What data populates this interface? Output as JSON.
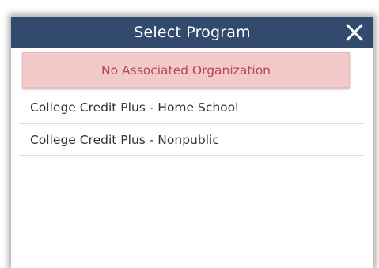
{
  "dialog": {
    "title": "Select Program",
    "close_icon": "close-icon",
    "colors": {
      "header_bg": "#324a6d",
      "header_text": "#ffffff",
      "alert_bg": "#f3c9c9",
      "alert_text": "#b24a4f"
    }
  },
  "alert": {
    "message": "No Associated Organization"
  },
  "programs": [
    {
      "label": "College Credit Plus - Home School"
    },
    {
      "label": "College Credit Plus - Nonpublic"
    }
  ]
}
